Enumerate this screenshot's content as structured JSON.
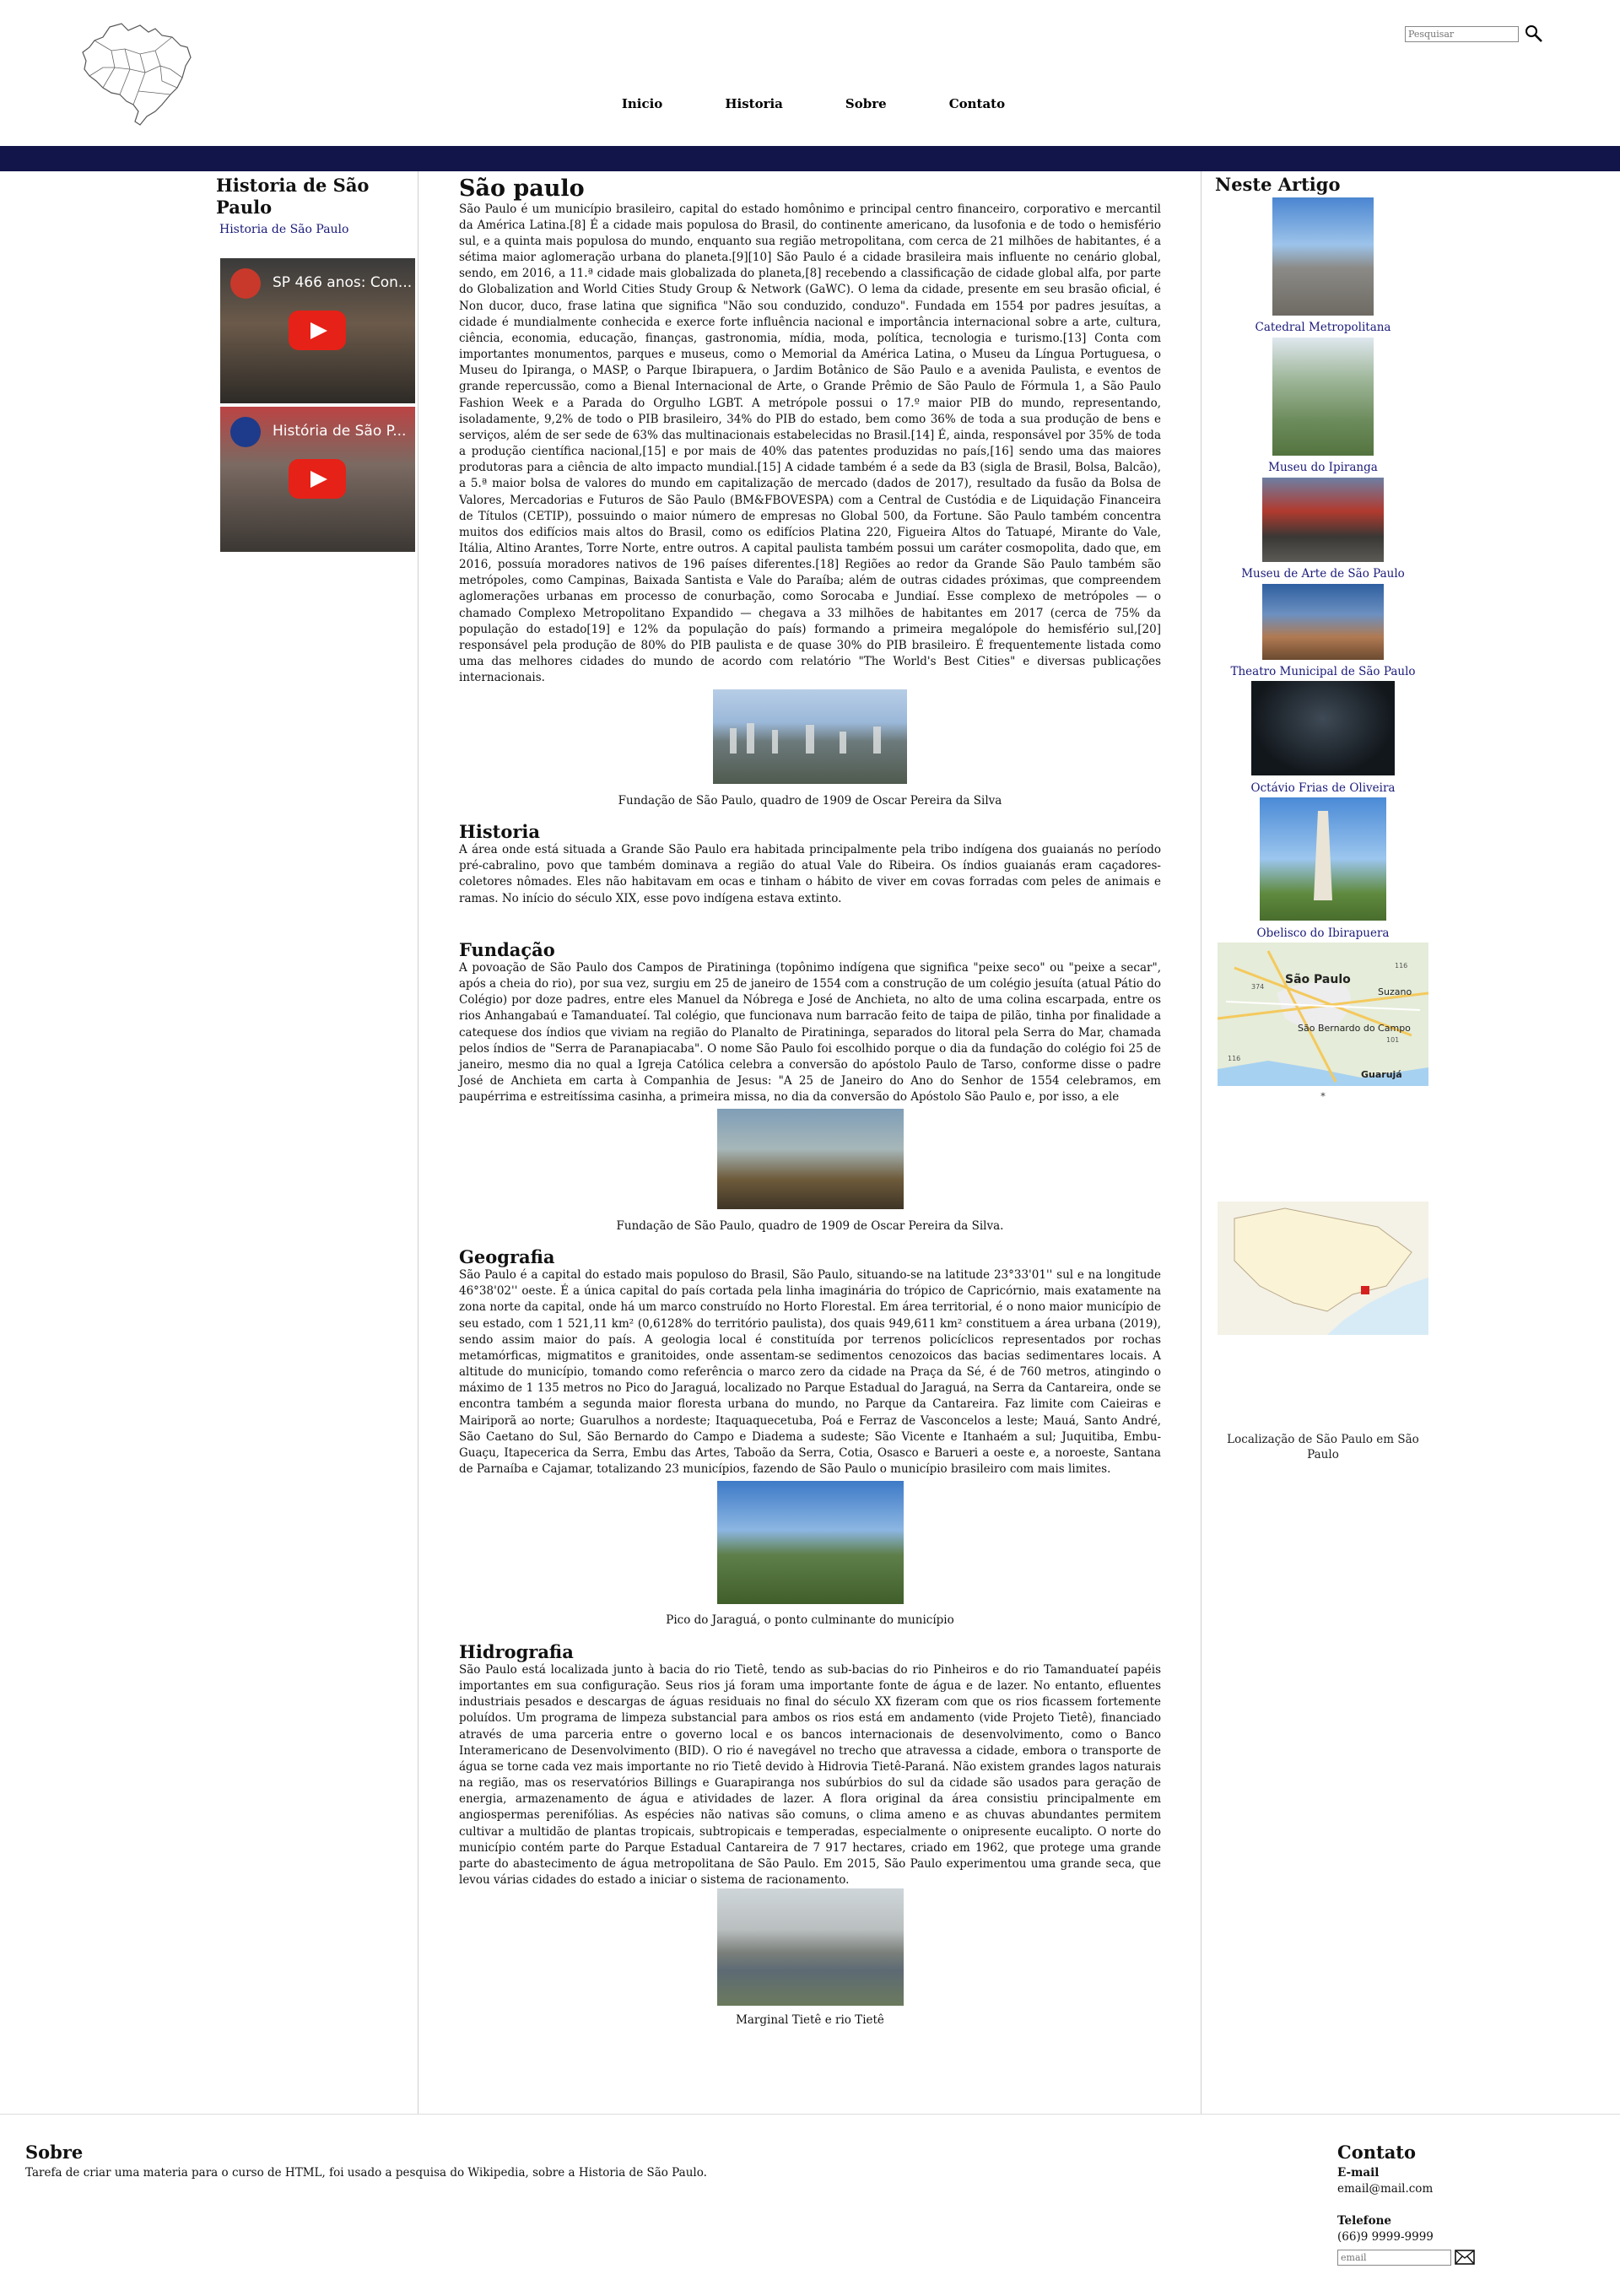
{
  "header": {
    "search_placeholder": "Pesquisar",
    "nav": [
      "Inicio",
      "Historia",
      "Sobre",
      "Contato"
    ]
  },
  "colors": {
    "banner": "#12154a",
    "link": "#1a1a7a"
  },
  "left": {
    "title": "Historia de São Paulo",
    "link": "Historia de São Paulo",
    "videos": [
      {
        "title": "SP 466 anos: Con..."
      },
      {
        "title": "História de São P..."
      }
    ]
  },
  "main": {
    "title": "São paulo",
    "intro": "São Paulo é um município brasileiro, capital do estado homônimo e principal centro financeiro, corporativo e mercantil da América Latina.[8] É a cidade mais populosa do Brasil, do continente americano, da lusofonia e de todo o hemisfério sul, e a quinta mais populosa do mundo, enquanto sua região metropolitana, com cerca de 21 milhões de habitantes, é a sétima maior aglomeração urbana do planeta.[9][10] São Paulo é a cidade brasileira mais influente no cenário global, sendo, em 2016, a 11.ª cidade mais globalizada do planeta,[8] recebendo a classificação de cidade global alfa, por parte do Globalization and World Cities Study Group & Network (GaWC). O lema da cidade, presente em seu brasão oficial, é Non ducor, duco, frase latina que significa \"Não sou conduzido, conduzo\". Fundada em 1554 por padres jesuítas, a cidade é mundialmente conhecida e exerce forte influência nacional e importância internacional sobre a arte, cultura, ciência, economia, educação, finanças, gastronomia, mídia, moda, política, tecnologia e turismo.[13] Conta com importantes monumentos, parques e museus, como o Memorial da América Latina, o Museu da Língua Portuguesa, o Museu do Ipiranga, o MASP, o Parque Ibirapuera, o Jardim Botânico de São Paulo e a avenida Paulista, e eventos de grande repercussão, como a Bienal Internacional de Arte, o Grande Prêmio de São Paulo de Fórmula 1, a São Paulo Fashion Week e a Parada do Orgulho LGBT. A metrópole possui o 17.º maior PIB do mundo, representando, isoladamente, 9,2% de todo o PIB brasileiro, 34% do PIB do estado, bem como 36% de toda a sua produção de bens e serviços, além de ser sede de 63% das multinacionais estabelecidas no Brasil.[14] É, ainda, responsável por 35% de toda a produção científica nacional,[15] e por mais de 40% das patentes produzidas no país,[16] sendo uma das maiores produtoras para a ciência de alto impacto mundial.[15] A cidade também é a sede da B3 (sigla de Brasil, Bolsa, Balcão), a 5.ª maior bolsa de valores do mundo em capitalização de mercado (dados de 2017), resultado da fusão da Bolsa de Valores, Mercadorias e Futuros de São Paulo (BM&FBOVESPA) com a Central de Custódia e de Liquidação Financeira de Títulos (CETIP), possuindo o maior número de empresas no Global 500, da Fortune. São Paulo também concentra muitos dos edifícios mais altos do Brasil, como os edifícios Platina 220, Figueira Altos do Tatuapé, Mirante do Vale, Itália, Altino Arantes, Torre Norte, entre outros. A capital paulista também possui um caráter cosmopolita, dado que, em 2016, possuía moradores nativos de 196 países diferentes.[18] Regiões ao redor da Grande São Paulo também são metrópoles, como Campinas, Baixada Santista e Vale do Paraíba; além de outras cidades próximas, que compreendem aglomerações urbanas em processo de conurbação, como Sorocaba e Jundiaí. Esse complexo de metrópoles — o chamado Complexo Metropolitano Expandido — chegava a 33 milhões de habitantes em 2017 (cerca de 75% da população do estado[19] e 12% da população do país) formando a primeira megalópole do hemisfério sul,[20] responsável pela produção de 80% do PIB paulista e de quase 30% do PIB brasileiro. É frequentemente listada como uma das melhores cidades do mundo de acordo com relatório \"The World's Best Cities\" e diversas publicações internacionais.",
    "fig1_caption": "Fundação de São Paulo, quadro de 1909 de Oscar Pereira da Silva",
    "historia_title": "Historia",
    "historia_text": "A área onde está situada a Grande São Paulo era habitada principalmente pela tribo indígena dos guaianás no período pré-cabralino, povo que também dominava a região do atual Vale do Ribeira. Os índios guaianás eram caçadores-coletores nômades. Eles não habitavam em ocas e tinham o hábito de viver em covas forradas com peles de animais e ramas. No início do século XIX, esse povo indígena estava extinto.",
    "fundacao_title": "Fundação",
    "fundacao_text": "A povoação de São Paulo dos Campos de Piratininga (topônimo indígena que significa \"peixe seco\" ou \"peixe a secar\", após a cheia do rio), por sua vez, surgiu em 25 de janeiro de 1554 com a construção de um colégio jesuíta (atual Pátio do Colégio) por doze padres, entre eles Manuel da Nóbrega e José de Anchieta, no alto de uma colina escarpada, entre os rios Anhangabaú e Tamanduateí. Tal colégio, que funcionava num barracão feito de taipa de pilão, tinha por finalidade a catequese dos índios que viviam na região do Planalto de Piratininga, separados do litoral pela Serra do Mar, chamada pelos índios de \"Serra de Paranapiacaba\". O nome São Paulo foi escolhido porque o dia da fundação do colégio foi 25 de janeiro, mesmo dia no qual a Igreja Católica celebra a conversão do apóstolo Paulo de Tarso, conforme disse o padre José de Anchieta em carta à Companhia de Jesus: \"A 25 de Janeiro do Ano do Senhor de 1554 celebramos, em paupérrima e estreitíssima casinha, a primeira missa, no dia da conversão do Apóstolo São Paulo e, por isso, a ele",
    "fig2_caption": "Fundação de São Paulo, quadro de 1909 de Oscar Pereira da Silva.",
    "geografia_title": "Geografia",
    "geografia_text": "São Paulo é a capital do estado mais populoso do Brasil, São Paulo, situando-se na latitude 23°33'01'' sul e na longitude 46°38'02'' oeste. É a única capital do país cortada pela linha imaginária do trópico de Capricórnio, mais exatamente na zona norte da capital, onde há um marco construído no Horto Florestal. Em área territorial, é o nono maior município de seu estado, com 1 521,11 km² (0,6128% do território paulista), dos quais 949,611 km² constituem a área urbana (2019), sendo assim maior do país. A geologia local é constituída por terrenos policíclicos representados por rochas metamórficas, migmatitos e granitoides, onde assentam-se sedimentos cenozoicos das bacias sedimentares locais. A altitude do município, tomando como referência o marco zero da cidade na Praça da Sé, é de 760 metros, atingindo o máximo de 1 135 metros no Pico do Jaraguá, localizado no Parque Estadual do Jaraguá, na Serra da Cantareira, onde se encontra também a segunda maior floresta urbana do mundo, no Parque da Cantareira. Faz limite com Caieiras e Mairiporã ao norte; Guarulhos a nordeste; Itaquaquecetuba, Poá e Ferraz de Vasconcelos a leste; Mauá, Santo André, São Caetano do Sul, São Bernardo do Campo e Diadema a sudeste; São Vicente e Itanhaém a sul; Juquitiba, Embu-Guaçu, Itapecerica da Serra, Embu das Artes, Taboão da Serra, Cotia, Osasco e Barueri a oeste e, a noroeste, Santana de Parnaíba e Cajamar, totalizando 23 municípios, fazendo de São Paulo o município brasileiro com mais limites.",
    "fig3_caption": "Pico do Jaraguá, o ponto culminante do município",
    "hidrografia_title": "Hidrografia",
    "hidrografia_text": "São Paulo está localizada junto à bacia do rio Tietê, tendo as sub-bacias do rio Pinheiros e do rio Tamanduateí papéis importantes em sua configuração. Seus rios já foram uma importante fonte de água e de lazer. No entanto, efluentes industriais pesados e descargas de águas residuais no final do século XX fizeram com que os rios ficassem fortemente poluídos. Um programa de limpeza substancial para ambos os rios está em andamento (vide Projeto Tietê), financiado através de uma parceria entre o governo local e os bancos internacionais de desenvolvimento, como o Banco Interamericano de Desenvolvimento (BID). O rio é navegável no trecho que atravessa a cidade, embora o transporte de água se torne cada vez mais importante no rio Tietê devido à Hidrovia Tietê-Paraná. Não existem grandes lagos naturais na região, mas os reservatórios Billings e Guarapiranga nos subúrbios do sul da cidade são usados para geração de energia, armazenamento de água e atividades de lazer. A flora original da área consistiu principalmente em angiospermas perenifólias. As espécies não nativas são comuns, o clima ameno e as chuvas abundantes permitem cultivar a multidão de plantas tropicais, subtropicais e temperadas, especialmente o onipresente eucalipto. O norte do município contém parte do Parque Estadual Cantareira de 7 917 hectares, criado em 1962, que protege uma grande parte do abastecimento de água metropolitana de São Paulo. Em 2015, São Paulo experimentou uma grande seca, que levou várias cidades do estado a iniciar o sistema de racionamento.",
    "fig4_caption": "Marginal Tietê e rio Tietê"
  },
  "right": {
    "title": "Neste Artigo",
    "items": [
      "Catedral Metropolitana",
      "Museu do Ipiranga",
      "Museu de Arte de São Paulo",
      "Theatro Municipal de São Paulo",
      "Octávio Frias de Oliveira",
      "Obelisco do Ibirapuera"
    ],
    "map1_labels": [
      "São Paulo",
      "Suzano",
      "São Bernardo do Campo",
      "Guarujá",
      "374",
      "116",
      "101",
      "116"
    ],
    "map1_note": "*",
    "map2_caption": "Localização de São Paulo em São Paulo"
  },
  "footer": {
    "sobre_title": "Sobre",
    "sobre_text": "Tarefa de criar uma materia para o curso de HTML, foi usado a pesquisa do Wikipedia, sobre a Historia de São Paulo.",
    "contato_title": "Contato",
    "email_label": "E-mail",
    "email_value": "email@mail.com",
    "phone_label": "Telefone",
    "phone_value": "(66)9 9999-9999",
    "email_placeholder": "email"
  }
}
